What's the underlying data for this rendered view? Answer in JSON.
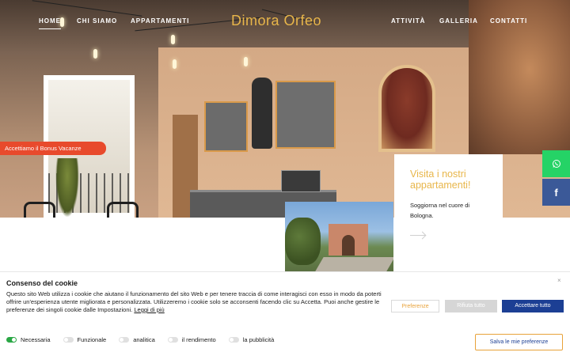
{
  "nav": {
    "home": "HOME",
    "chi_siamo": "CHI SIAMO",
    "appartamenti": "APPARTAMENTI",
    "attivita": "ATTIVITÀ",
    "galleria": "GALLERIA",
    "contatti": "CONTATTI"
  },
  "brand": {
    "logo": "Dimora Orfeo",
    "accent": "#e8b64a"
  },
  "badge": {
    "text": "Accettiamo il Bonus Vacanze",
    "color": "#e84a2c"
  },
  "social": {
    "whatsapp_icon": "whatsapp-icon",
    "facebook_icon": "facebook-icon",
    "facebook_glyph": "f"
  },
  "promo": {
    "title": "Visita i nostri appartamenti!",
    "text": "Soggiorna nel cuore di Bologna."
  },
  "cookie": {
    "title": "Consenso del cookie",
    "text": "Questo sito Web utilizza i cookie che aiutano il funzionamento del sito Web e per tenere traccia di come interagisci con esso in modo da poterti offrire un'esperienza utente migliorata e personalizzata. Utilizzeremo i cookie solo se acconsenti facendo clic su Accetta. Puoi anche gestire le preferenze dei singoli cookie dalle Impostazioni.",
    "link": "Leggi di più",
    "close": "×",
    "buttons": {
      "preferences": "Preferenze",
      "reject": "Rifiuta tutto",
      "accept": "Accettare tutto",
      "save": "Salva le mie preferenze"
    },
    "toggles": [
      {
        "label": "Necessaria",
        "on": true
      },
      {
        "label": "Funzionale",
        "on": false
      },
      {
        "label": "analitica",
        "on": false
      },
      {
        "label": "il rendimento",
        "on": false
      },
      {
        "label": "la pubblicità",
        "on": false
      }
    ],
    "accept_color": "#1c3f94",
    "toggle_on_color": "#2aa745"
  }
}
